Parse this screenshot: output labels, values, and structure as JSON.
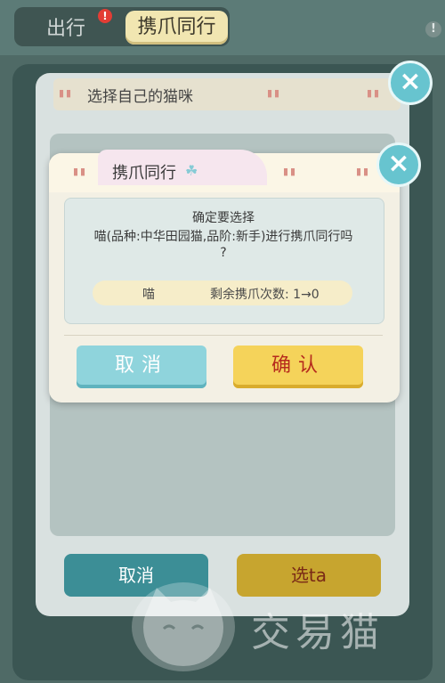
{
  "top_tabs": {
    "out_label": "出行",
    "out_badge": "!",
    "carry_label": "携爪同行"
  },
  "info_icon": "!",
  "back_panel": {
    "title": "选择自己的猫咪",
    "cancel_label": "取消",
    "select_label": "选ta"
  },
  "dialog": {
    "title": "携爪同行",
    "message_line1": "确定要选择",
    "message_line2": "喵(品种:中华田园猫,品阶:新手)进行携爪同行吗",
    "message_line3": "?",
    "cat_name": "喵",
    "remaining": "剩余携爪次数: 1→0",
    "cancel_label": "取消",
    "confirm_label": "确认"
  },
  "close_glyph": "×",
  "watermark": "交易猫",
  "icons": [
    "info-icon",
    "close-icon",
    "clover-icon",
    "cat-logo-icon"
  ],
  "colors": {
    "accent_teal": "#67c4cf",
    "confirm_yellow": "#f5d35a",
    "badge_red": "#e33d35"
  }
}
